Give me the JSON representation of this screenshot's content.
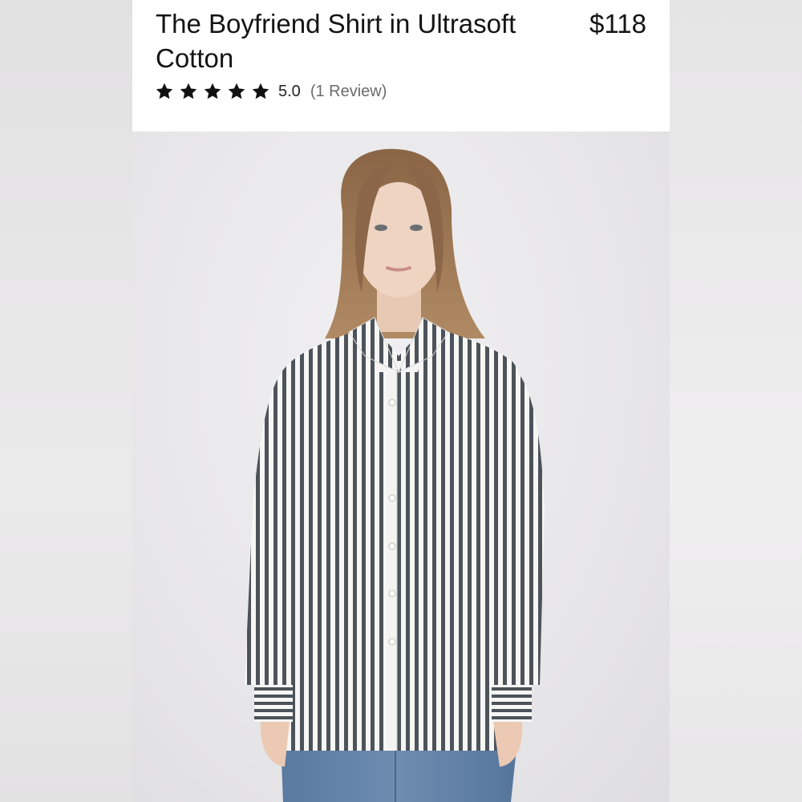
{
  "product": {
    "title": "The Boyfriend Shirt in Ultrasoft Cotton",
    "price": "$118",
    "rating": {
      "stars": 5,
      "max_stars": 5,
      "score": "5.0",
      "reviews_label": "(1 Review)"
    },
    "image": {
      "description_icon": "product-photo"
    }
  },
  "colors": {
    "text": "#141414",
    "muted": "#6b6b6b",
    "star": "#111111",
    "stripe_dark": "#4a4f55",
    "stripe_light": "#f7f7f5",
    "denim": "#5f7ea3"
  }
}
